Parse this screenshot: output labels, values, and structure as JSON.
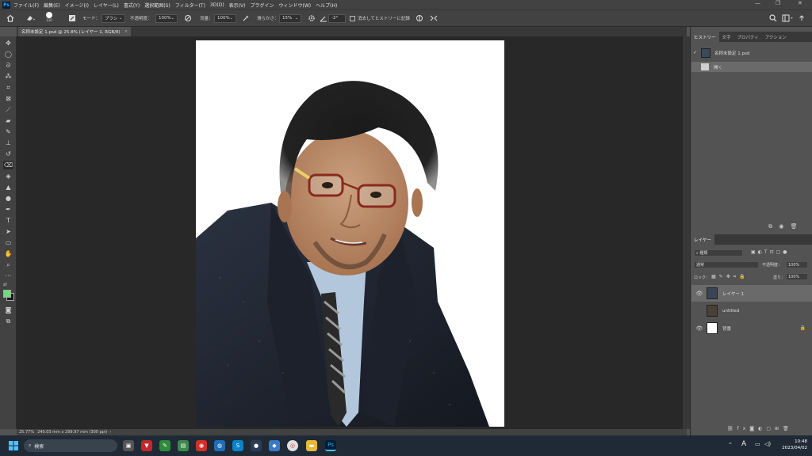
{
  "app": {
    "logo": "Ps"
  },
  "menu": [
    "ファイル(F)",
    "編集(E)",
    "イメージ(I)",
    "レイヤー(L)",
    "書式(Y)",
    "選択範囲(S)",
    "フィルター(T)",
    "3D(D)",
    "表示(V)",
    "プラグイン",
    "ウィンドウ(W)",
    "ヘルプ(H)"
  ],
  "window_controls": {
    "minimize": "—",
    "maximize": "❐",
    "close": "✕"
  },
  "options": {
    "brush_size": "110",
    "mode_label": "モード：",
    "mode_value": "ブラシ",
    "opacity_label": "不透明度：",
    "opacity_value": "100%",
    "flow_label": "流量：",
    "flow_value": "100%",
    "smoothing_label": "滑らかさ：",
    "smoothing_value": "15%",
    "angle_value": "-2°",
    "history_checkbox_label": "消去してヒストリーに記録"
  },
  "document": {
    "tab_title": "名称未設定 1.psd @ 25.8% (レイヤー 1, RGB/8)",
    "tab_close": "×",
    "status_zoom": "25.77%",
    "status_info": "240.03 mm x 299.97 mm (300 ppi)"
  },
  "panels": {
    "top_tabs": [
      "ヒストリー",
      "文字",
      "プロパティ",
      "アクション"
    ],
    "history_source": "名称未設定 1.psd",
    "history_items": [
      "開く"
    ],
    "layers_tab": "レイヤー",
    "kind_filter": "種類",
    "blend_mode": "通常",
    "opacity_label": "不透明度：",
    "opacity_value": "100%",
    "lock_label": "ロック：",
    "fill_label": "塗り：",
    "fill_value": "100%",
    "layers": [
      {
        "name": "レイヤー 1",
        "visible": true,
        "selected": true
      },
      {
        "name": "untitled",
        "visible": false,
        "selected": false
      },
      {
        "name": "背景",
        "visible": true,
        "selected": false,
        "locked": true
      }
    ]
  },
  "taskbar": {
    "search_placeholder": "検索",
    "time": "10:48",
    "date": "2023/04/02",
    "ime": "A"
  },
  "colors": {
    "foreground": "#6fdc7a",
    "background": "#1a1a1a",
    "ps_blue": "#31a8ff"
  }
}
